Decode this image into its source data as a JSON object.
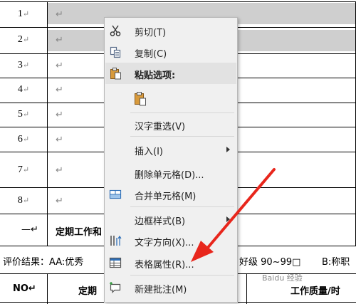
{
  "table": {
    "return_mark": "↵",
    "rows": [
      {
        "num": "1",
        "highlighted": true
      },
      {
        "num": "2",
        "highlighted": true
      },
      {
        "num": "3",
        "highlighted": false
      },
      {
        "num": "4",
        "highlighted": false
      },
      {
        "num": "5",
        "highlighted": false
      },
      {
        "num": "6",
        "highlighted": false
      },
      {
        "num": "7",
        "highlighted": false
      },
      {
        "num": "8",
        "highlighted": false
      }
    ],
    "last_row_label": "—↵",
    "last_row_text": "定期工作和",
    "eval_line": "评价结果：AA:优秀",
    "eval_line_mid": "好级 90~99□",
    "eval_line_right": "B:称职",
    "header_no": "NO↵",
    "header_def": "定期",
    "header_quality": "工作质量/时"
  },
  "context_menu": {
    "items": [
      {
        "label": "剪切(T)",
        "icon": "scissors-icon"
      },
      {
        "label": "复制(C)",
        "icon": "copy-icon"
      },
      {
        "label": "粘贴选项:",
        "icon": "paste-icon"
      },
      {
        "label": "",
        "icon": "paste-keep-format-icon"
      },
      {
        "label": "汉字重选(V)",
        "icon": ""
      },
      {
        "label": "插入(I)",
        "icon": "",
        "submenu": true
      },
      {
        "label": "删除单元格(D)...",
        "icon": ""
      },
      {
        "label": "合并单元格(M)",
        "icon": "merge-cells-icon"
      },
      {
        "label": "边框样式(B)",
        "icon": "",
        "submenu": true
      },
      {
        "label": "文字方向(X)...",
        "icon": "text-direction-icon"
      },
      {
        "label": "表格属性(R)...",
        "icon": "table-properties-icon"
      },
      {
        "label": "新建批注(M)",
        "icon": "new-comment-icon"
      }
    ]
  },
  "annotation": {
    "arrow_color": "#e8261c"
  },
  "watermark": "Baidu 经验"
}
